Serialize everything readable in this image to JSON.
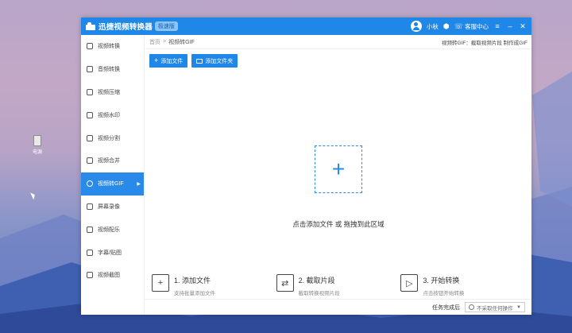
{
  "colors": {
    "accent": "#1f87e8",
    "active_item": "#2a8ae9"
  },
  "desktop": {
    "icon_label": "电源"
  },
  "titlebar": {
    "app_name": "迅捷视频转换器",
    "edition": "极速版",
    "username": "小秋",
    "service": "客服中心",
    "icons": [
      "avatar",
      "cube-icon",
      "service-icon",
      "menu-icon",
      "minimize-icon",
      "close-icon"
    ]
  },
  "sidebar": {
    "items": [
      {
        "label": "视频转换",
        "active": false
      },
      {
        "label": "音频转换",
        "active": false
      },
      {
        "label": "视频压缩",
        "active": false
      },
      {
        "label": "视频水印",
        "active": false
      },
      {
        "label": "视频分割",
        "active": false
      },
      {
        "label": "视频合并",
        "active": false
      },
      {
        "label": "视频转GIF",
        "active": true
      },
      {
        "label": "屏幕录像",
        "active": false
      },
      {
        "label": "视频配乐",
        "active": false
      },
      {
        "label": "字幕/贴图",
        "active": false
      },
      {
        "label": "视频截图",
        "active": false
      }
    ]
  },
  "breadcrumb": {
    "home": "首页",
    "separator": ">",
    "current": "视频转GIF",
    "description": "视频转GIF：截取视频片段 制作成GIF"
  },
  "toolbar": {
    "add_file": "添加文件",
    "add_folder": "添加文件夹"
  },
  "dropzone": {
    "hint": "点击添加文件 或 拖拽到此区域"
  },
  "steps": [
    {
      "title": "1. 添加文件",
      "subtitle": "支持批量添加文件",
      "icon": "add-file-icon"
    },
    {
      "title": "2. 截取片段",
      "subtitle": "截取转换视频片段",
      "icon": "clip-icon"
    },
    {
      "title": "3. 开始转换",
      "subtitle": "点击按钮开始转换",
      "icon": "convert-icon"
    }
  ],
  "statusbar": {
    "label": "任务完成后",
    "select_value": "不采取任何操作"
  }
}
